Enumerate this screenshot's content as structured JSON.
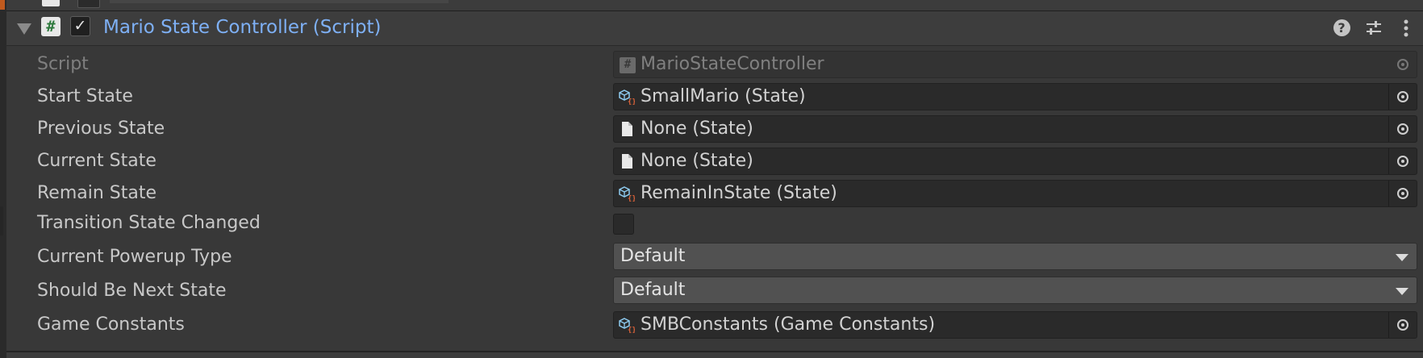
{
  "component": {
    "title": "Mario State Controller (Script)",
    "enabled": true,
    "header_icons": [
      "script-hash-icon",
      "help-icon",
      "presets-icon",
      "context-menu-icon"
    ]
  },
  "fields": {
    "script": {
      "label": "Script",
      "value": "MarioStateController",
      "icon": "script-hash-icon"
    },
    "start_state": {
      "label": "Start State",
      "value": "SmallMario (State)",
      "icon": "scriptable-object-icon"
    },
    "previous_state": {
      "label": "Previous State",
      "value": "None (State)",
      "icon": "file-icon"
    },
    "current_state": {
      "label": "Current State",
      "value": "None (State)",
      "icon": "file-icon"
    },
    "remain_state": {
      "label": "Remain State",
      "value": "RemainInState (State)",
      "icon": "scriptable-object-icon"
    },
    "transition_state_changed": {
      "label": "Transition State Changed",
      "checked": false
    },
    "current_powerup_type": {
      "label": "Current Powerup Type",
      "value": "Default"
    },
    "should_be_next_state": {
      "label": "Should Be Next State",
      "value": "Default"
    },
    "game_constants": {
      "label": "Game Constants",
      "value": "SMBConstants (Game Constants)",
      "icon": "scriptable-object-icon"
    }
  },
  "colors": {
    "title": "#7eb0f5",
    "background": "#383838",
    "field_bg": "#2a2a2a",
    "dropdown_bg": "#515151"
  }
}
